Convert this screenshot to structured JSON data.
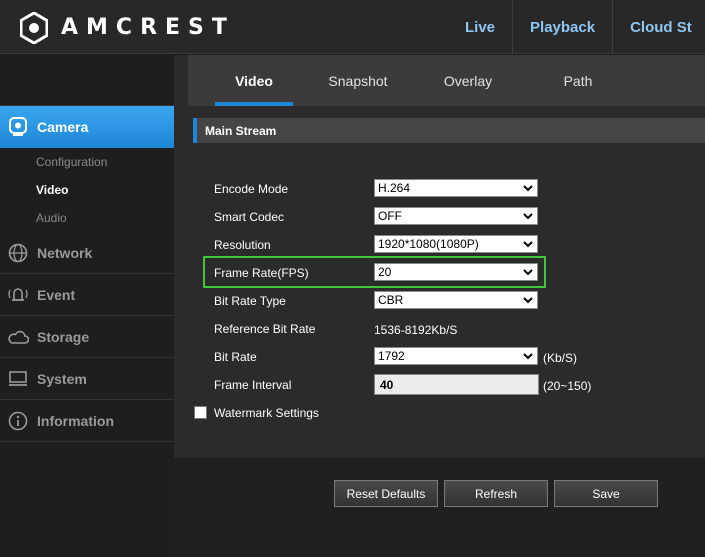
{
  "brand": "AMCREST",
  "top_nav": [
    "Live",
    "Playback",
    "Cloud St"
  ],
  "sidebar": {
    "items": [
      {
        "label": "Camera",
        "icon": "camera-icon",
        "active": true
      },
      {
        "label": "Network",
        "icon": "network-icon",
        "active": false
      },
      {
        "label": "Event",
        "icon": "event-icon",
        "active": false
      },
      {
        "label": "Storage",
        "icon": "storage-icon",
        "active": false
      },
      {
        "label": "System",
        "icon": "system-icon",
        "active": false
      },
      {
        "label": "Information",
        "icon": "information-icon",
        "active": false
      }
    ],
    "camera_sub": [
      "Configuration",
      "Video",
      "Audio"
    ],
    "active_sub": "Video"
  },
  "tabs": [
    "Video",
    "Snapshot",
    "Overlay",
    "Path"
  ],
  "active_tab": "Video",
  "section_title": "Main Stream",
  "form": {
    "encode_mode": {
      "label": "Encode Mode",
      "value": "H.264"
    },
    "smart_codec": {
      "label": "Smart Codec",
      "value": "OFF"
    },
    "resolution": {
      "label": "Resolution",
      "value": "1920*1080(1080P)"
    },
    "frame_rate": {
      "label": "Frame Rate(FPS)",
      "value": "20"
    },
    "bit_rate_type": {
      "label": "Bit Rate Type",
      "value": "CBR"
    },
    "reference_bit_rate": {
      "label": "Reference Bit Rate",
      "value": "1536-8192Kb/S"
    },
    "bit_rate": {
      "label": "Bit Rate",
      "value": "1792",
      "unit": "(Kb/S)"
    },
    "frame_interval": {
      "label": "Frame Interval",
      "value": "40",
      "unit": "(20~150)"
    },
    "watermark": {
      "label": "Watermark Settings",
      "checked": false
    }
  },
  "buttons": {
    "reset": "Reset Defaults",
    "refresh": "Refresh",
    "save": "Save"
  },
  "colors": {
    "accent": "#1d87d6",
    "highlight": "#3ec93a",
    "nav_text": "#8fc6f2"
  }
}
